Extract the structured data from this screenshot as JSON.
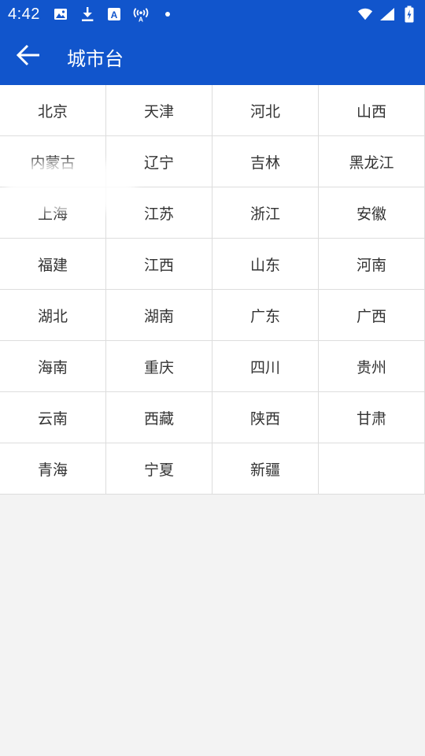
{
  "status_bar": {
    "time": "4:42",
    "left_icons": [
      "image-icon",
      "download-icon",
      "text-a-icon",
      "broadcast-icon",
      "dot-icon"
    ],
    "right_icons": [
      "wifi-icon",
      "signal-icon",
      "battery-icon"
    ]
  },
  "app_bar": {
    "title": "城市台",
    "back_icon": "arrow-left-icon"
  },
  "provinces": [
    "北京",
    "天津",
    "河北",
    "山西",
    "内蒙古",
    "辽宁",
    "吉林",
    "黑龙江",
    "上海",
    "江苏",
    "浙江",
    "安徽",
    "福建",
    "江西",
    "山东",
    "河南",
    "湖北",
    "湖南",
    "广东",
    "广西",
    "海南",
    "重庆",
    "四川",
    "贵州",
    "云南",
    "西藏",
    "陕西",
    "甘肃",
    "青海",
    "宁夏",
    "新疆",
    ""
  ],
  "colors": {
    "primary": "#1155cc",
    "background": "#f3f3f3",
    "grid_line": "#dddddd",
    "text": "#333333"
  }
}
